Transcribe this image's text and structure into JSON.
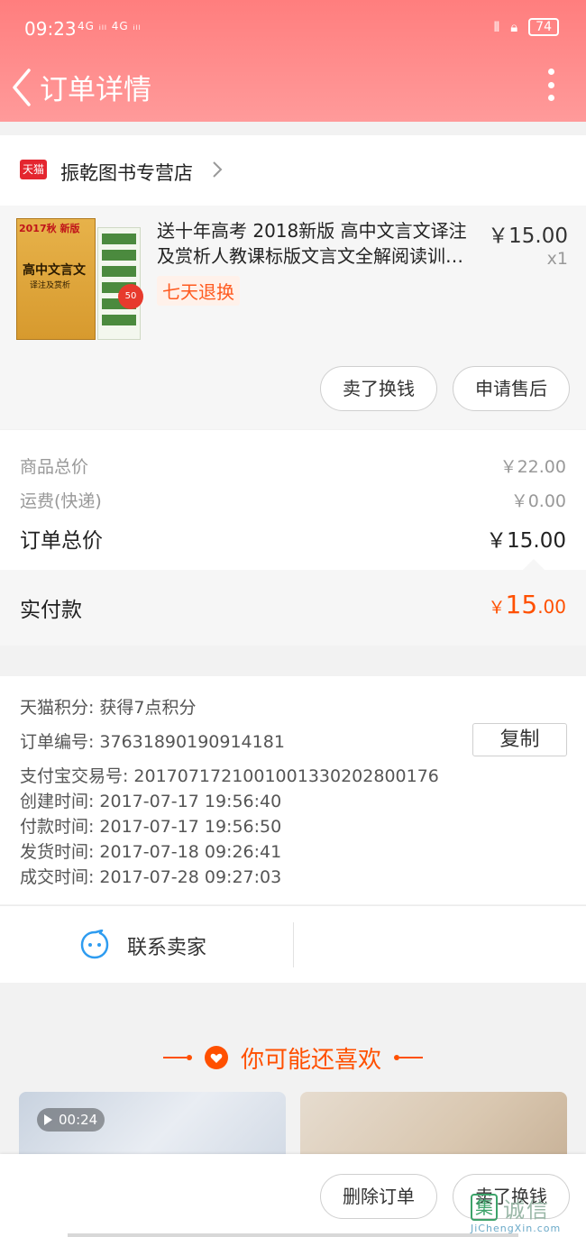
{
  "status": {
    "time": "09:23",
    "signal": "4G ᵢₗₗ 4G ᵢₗₗ",
    "battery": "74"
  },
  "nav": {
    "title": "订单详情"
  },
  "shop": {
    "badge": "天猫",
    "name": "振乾图书专营店"
  },
  "product": {
    "cover_top": "2017秋 新版",
    "cover_title": "高中文言文",
    "cover_sub": "译注及赏析",
    "cover_badge": "50",
    "title_line1": "送十年高考 2018新版 高中文言文译注",
    "title_line2": "及赏析人教课标版文言文全解阅读训…",
    "price": "￥15.00",
    "qty": "x1",
    "tag": "七天退换",
    "btn_sell": "卖了换钱",
    "btn_after_sale": "申请售后"
  },
  "prices": {
    "goods_label": "商品总价",
    "goods_value": "￥22.00",
    "shipping_label": "运费(快递)",
    "shipping_value": "￥0.00",
    "order_total_label": "订单总价",
    "order_total_value": "￥15.00",
    "paid_label": "实付款",
    "paid_symbol": "￥",
    "paid_int": "15",
    "paid_dec": ".00"
  },
  "info": {
    "points_label": "天猫积分:",
    "points_value": "获得7点积分",
    "order_no_label": "订单编号:",
    "order_no_value": "37631890190914181",
    "copy_label": "复制",
    "alipay_label": "支付宝交易号:",
    "alipay_value": "2017071721001001330202800176",
    "created_label": "创建时间:",
    "created_value": "2017-07-17 19:56:40",
    "paid_time_label": "付款时间:",
    "paid_time_value": "2017-07-17 19:56:50",
    "shipped_label": "发货时间:",
    "shipped_value": "2017-07-18 09:26:41",
    "closed_label": "成交时间:",
    "closed_value": "2017-07-28 09:27:03"
  },
  "contact": {
    "label": "联系卖家"
  },
  "recommend": {
    "title": "你可能还喜欢",
    "video_duration": "00:24"
  },
  "bottom": {
    "delete_label": "删除订单",
    "sell_label": "卖了换钱"
  },
  "watermark": {
    "box": "集",
    "text": "诚信",
    "url": "JiChengXin.com"
  },
  "colors": {
    "header": "#ff8a8a",
    "accent": "#ff5000",
    "tmall": "#e4262f"
  }
}
